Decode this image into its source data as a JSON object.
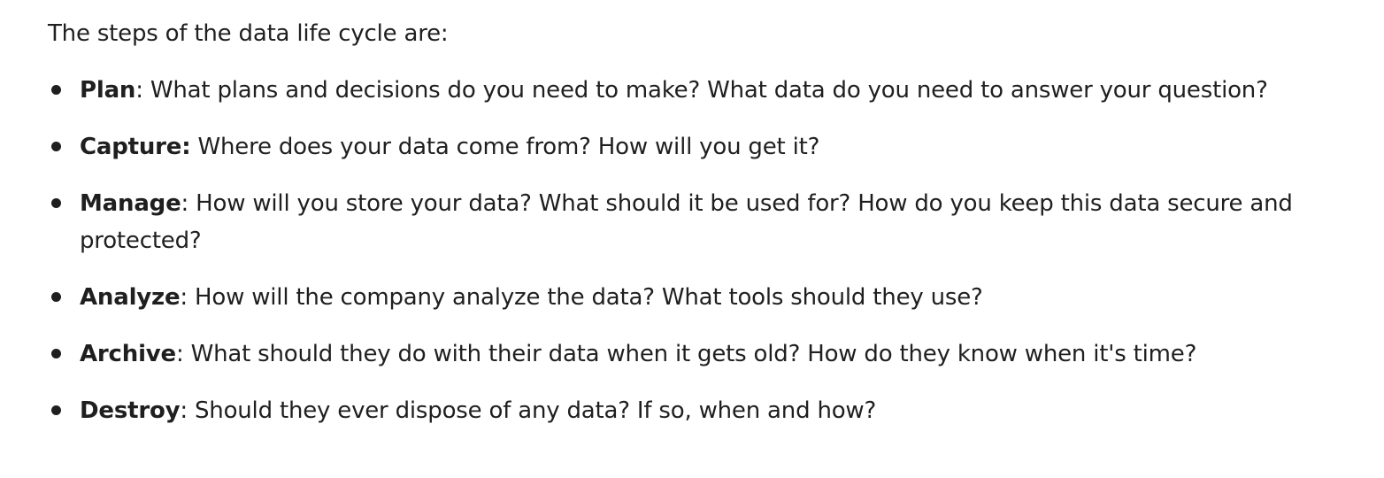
{
  "intro": "The steps of the data life cycle are:",
  "steps": [
    {
      "term": "Plan",
      "sep": ":",
      "text": " What plans and decisions do you need to make? What data do you need to answer your question?"
    },
    {
      "term": "Capture:",
      "sep": "",
      "text": " Where does your data come from? How will you get it?"
    },
    {
      "term": "Manage",
      "sep": ":",
      "text": " How will you store your data? What should it be used for? How do you keep this data secure and protected?"
    },
    {
      "term": "Analyze",
      "sep": ":",
      "text": " How will the company analyze the data? What tools should they use?"
    },
    {
      "term": "Archive",
      "sep": ":",
      "text": " What should they do with their data when it gets old? How do they know when it's time?"
    },
    {
      "term": "Destroy",
      "sep": ":",
      "text": " Should they ever dispose of any data? If so, when and how?"
    }
  ]
}
